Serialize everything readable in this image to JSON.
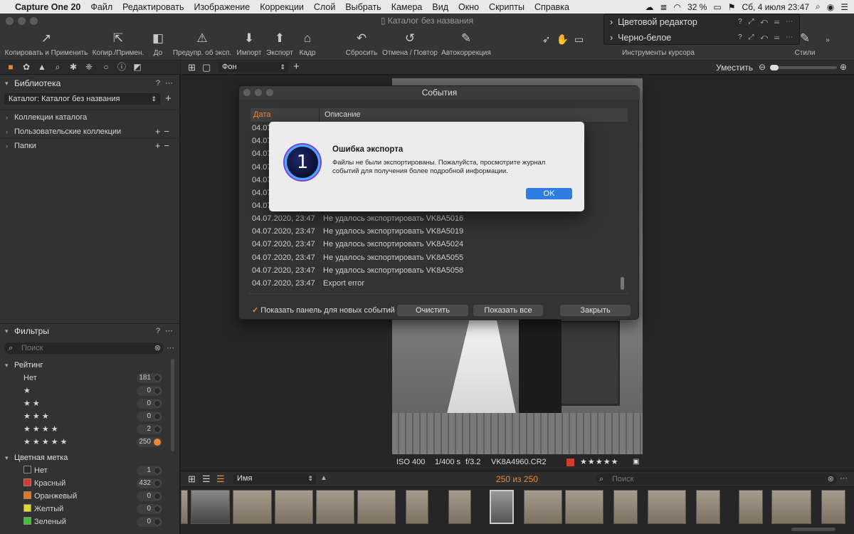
{
  "menubar": {
    "apple": "",
    "app": "Capture One 20",
    "items": [
      "Файл",
      "Редактировать",
      "Изображение",
      "Коррекции",
      "Слой",
      "Выбрать",
      "Камера",
      "Вид",
      "Окно",
      "Скрипты",
      "Справка"
    ],
    "battery": "32 %",
    "datetime": "Сб, 4 июля  23:47"
  },
  "window": {
    "title": "Каталог без названия"
  },
  "toolbar": {
    "items": [
      {
        "label": "Копировать и Применить",
        "icon": "↗"
      },
      {
        "label": "Копир./Примен.",
        "icon": "⇱"
      },
      {
        "label": "До",
        "icon": "◧"
      },
      {
        "label": "Предупр. об эксп.",
        "icon": "⚠"
      },
      {
        "label": "Импорт",
        "icon": "⬇"
      },
      {
        "label": "Экспорт",
        "icon": "⬆"
      },
      {
        "label": "Кадр",
        "icon": "⌂"
      },
      {
        "label": "Сбросить",
        "icon": "↶"
      },
      {
        "label": "Отмена / Повтор",
        "icon": "↺"
      },
      {
        "label": "Автокоррекция",
        "icon": "✎"
      },
      {
        "label": "Инструменты курсора",
        "icon": ""
      },
      {
        "label": "Стили",
        "icon": "✎"
      }
    ]
  },
  "cursor_popup": {
    "rows": [
      "Цветовой редактор",
      "Черно-белое"
    ]
  },
  "library": {
    "title": "Библиотека",
    "catalog_select": "Каталог: Каталог без названия",
    "rows": [
      "Коллекции каталога",
      "Пользовательские коллекции",
      "Папки"
    ]
  },
  "filters": {
    "title": "Фильтры",
    "search_placeholder": "Поиск",
    "rating_title": "Рейтинг",
    "rating": [
      {
        "label": "Нет",
        "count": "181"
      },
      {
        "label": "★",
        "count": "0"
      },
      {
        "label": "★ ★",
        "count": "0"
      },
      {
        "label": "★ ★ ★",
        "count": "0"
      },
      {
        "label": "★ ★ ★ ★",
        "count": "2"
      },
      {
        "label": "★ ★ ★ ★ ★",
        "count": "250",
        "active": true
      }
    ],
    "color_title": "Цветная метка",
    "colors": [
      {
        "label": "Нет",
        "count": "1",
        "color": "#2a2a2a"
      },
      {
        "label": "Красный",
        "count": "432",
        "color": "#d23b2f"
      },
      {
        "label": "Оранжевый",
        "count": "0",
        "color": "#e07a22"
      },
      {
        "label": "Желтый",
        "count": "0",
        "color": "#e2d531"
      },
      {
        "label": "Зеленый",
        "count": "0",
        "color": "#4bbd3e"
      }
    ]
  },
  "viewbar": {
    "background_select": "Фон",
    "fit_label": "Уместить"
  },
  "image_info": {
    "iso": "ISO 400",
    "shutter": "1/400 s",
    "aperture": "f/3.2",
    "filename": "VK8A4960.CR2",
    "stars": "★ ★ ★ ★ ★"
  },
  "filmstrip_bar": {
    "sort": "Имя",
    "count": "250 из 250",
    "search_placeholder": "Поиск"
  },
  "events_dialog": {
    "title": "События",
    "col_date": "Дата",
    "col_desc": "Описание",
    "hidden_rows": [
      "04.07",
      "04.07",
      "04.07",
      "04.07",
      "04.07",
      "04.07",
      "04.07"
    ],
    "rows": [
      {
        "date": "04.07.2020, 23:47",
        "desc": "Не удалось экспортировать VK8A5016"
      },
      {
        "date": "04.07.2020, 23:47",
        "desc": "Не удалось экспортировать VK8A5019"
      },
      {
        "date": "04.07.2020, 23:47",
        "desc": "Не удалось экспортировать VK8A5024"
      },
      {
        "date": "04.07.2020, 23:47",
        "desc": "Не удалось экспортировать VK8A5055"
      },
      {
        "date": "04.07.2020, 23:47",
        "desc": "Не удалось экспортировать VK8A5058"
      },
      {
        "date": "04.07.2020, 23:47",
        "desc": "Export error"
      }
    ],
    "show_panel_checkbox": "Показать панель для новых событий",
    "clear_button": "Очистить",
    "show_all_button": "Показать все",
    "close_button": "Закрыть"
  },
  "alert": {
    "logo_glyph": "1",
    "title": "Ошибка экспорта",
    "message": "Файлы не были экспортированы. Пожалуйста, просмотрите журнал событий для получения более подробной информации.",
    "ok": "OK"
  },
  "colors": {
    "accent": "#e8883a",
    "ok_button": "#2f7de1"
  }
}
